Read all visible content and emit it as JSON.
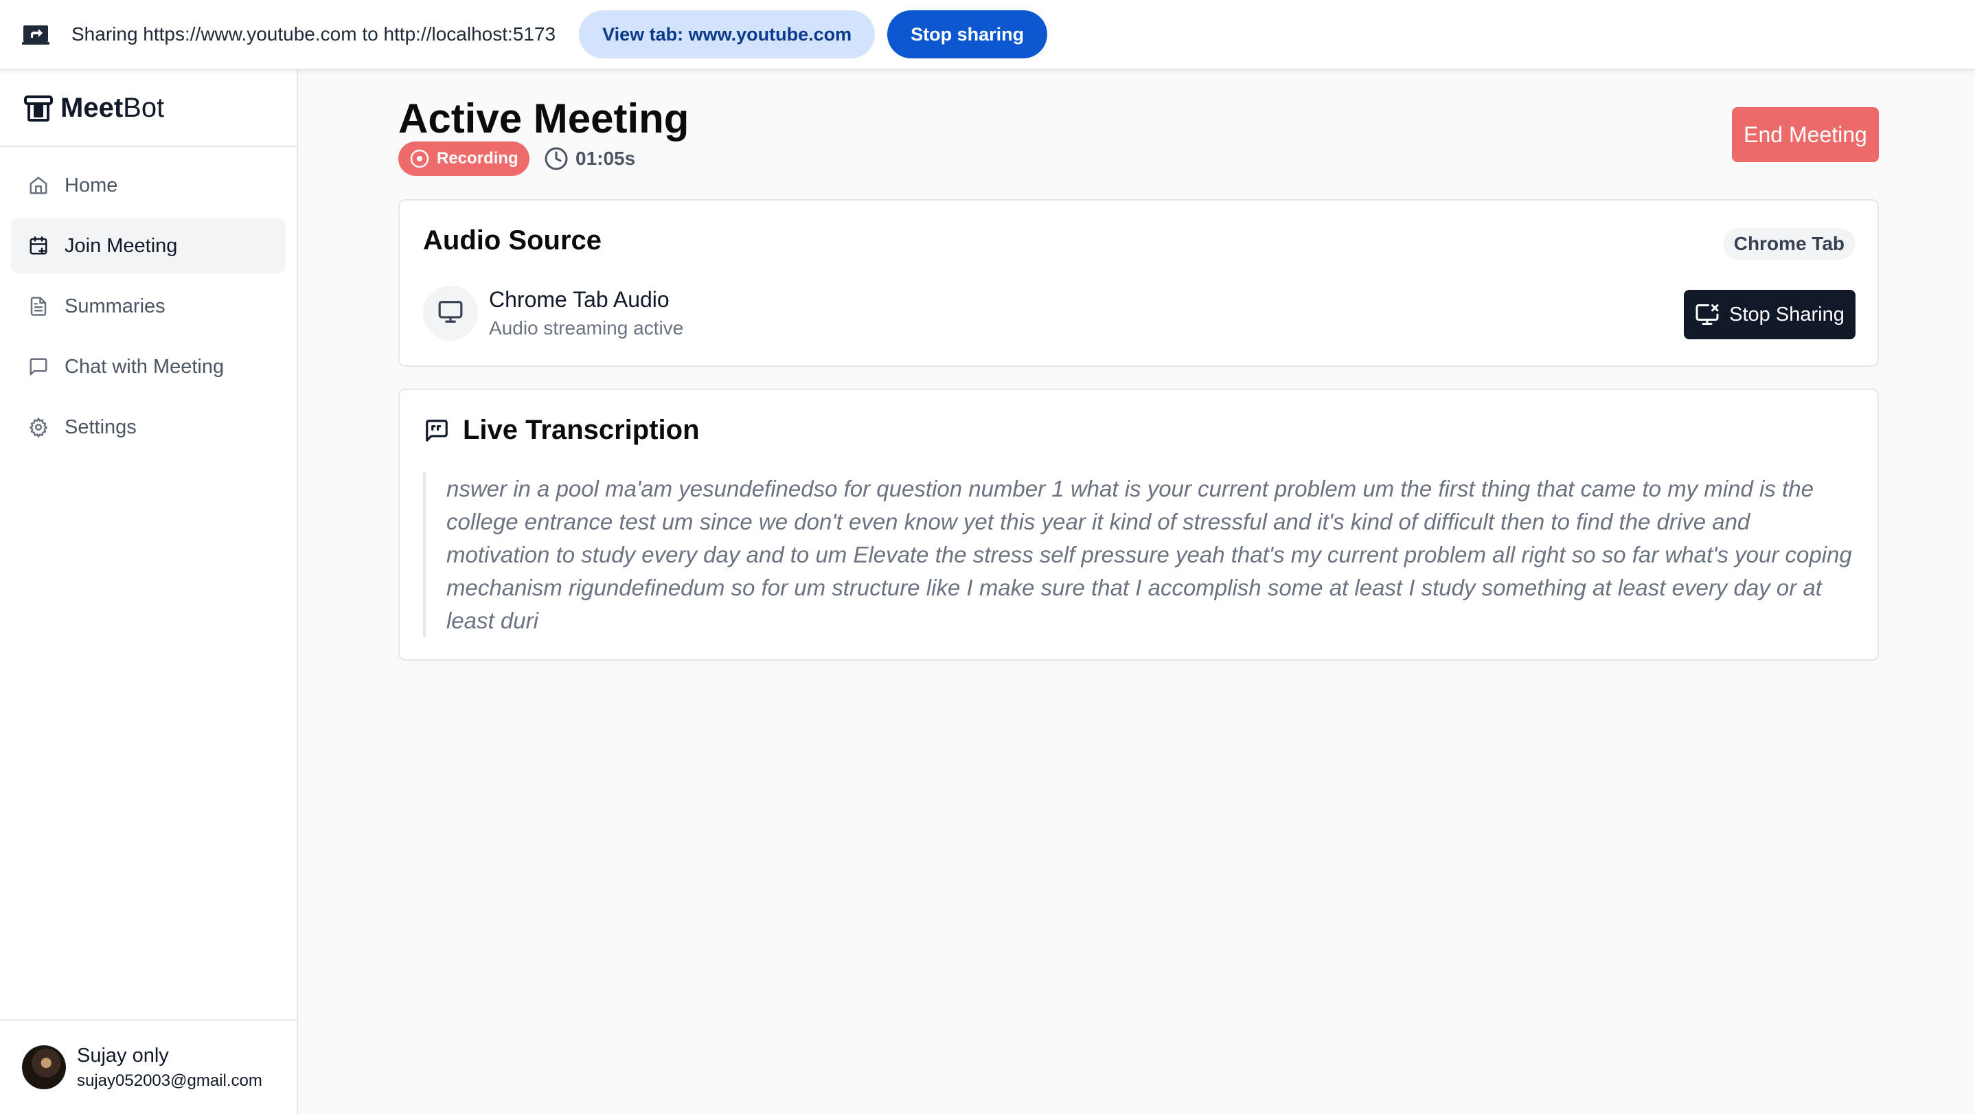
{
  "share_bar": {
    "text": "Sharing https://www.youtube.com to http://localhost:5173",
    "view_tab_label": "View tab: www.youtube.com",
    "stop_sharing_label": "Stop sharing"
  },
  "sidebar": {
    "brand_bold": "Meet",
    "brand_light": "Bot",
    "items": [
      {
        "label": "Home",
        "icon": "home-icon",
        "active": false
      },
      {
        "label": "Join Meeting",
        "icon": "calendar-plus-icon",
        "active": true
      },
      {
        "label": "Summaries",
        "icon": "document-icon",
        "active": false
      },
      {
        "label": "Chat with Meeting",
        "icon": "chat-icon",
        "active": false
      },
      {
        "label": "Settings",
        "icon": "gear-icon",
        "active": false
      }
    ],
    "user": {
      "name": "Sujay only",
      "email": "sujay052003@gmail.com"
    }
  },
  "main": {
    "title": "Active Meeting",
    "recording_label": "Recording",
    "timer": "01:05s",
    "end_button_label": "End Meeting",
    "audio_source": {
      "title": "Audio Source",
      "chip": "Chrome Tab",
      "device_name": "Chrome Tab Audio",
      "device_status": "Audio streaming active",
      "stop_label": "Stop Sharing"
    },
    "transcription": {
      "title": "Live Transcription",
      "text": "nswer in a pool ma'am yesundefinedso for question number 1 what is your current problem um the first thing that came to my mind is the college entrance test um since we don't even know yet this year it kind of stressful and it's kind of difficult then to find the drive and motivation to study every day and to um Elevate the stress self pressure yeah that's my current problem all right so so far what's your coping mechanism rigundefinedum so for um structure like I make sure that I accomplish some at least I study something at least every day or at least duri"
    }
  },
  "colors": {
    "recording": "#ef6b6b",
    "end_button": "#ec6a6a",
    "stop_sharing_chrome": "#0b57d0",
    "view_tab_chrome": "#d3e3fd",
    "dark_button": "#111827"
  }
}
